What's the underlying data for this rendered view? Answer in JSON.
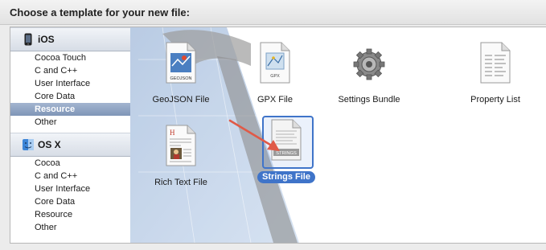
{
  "dialog": {
    "title": "Choose a template for your new file:"
  },
  "sidebar": {
    "groups": [
      {
        "label": "iOS",
        "items": [
          "Cocoa Touch",
          "C and C++",
          "User Interface",
          "Core Data",
          "Resource",
          "Other"
        ]
      },
      {
        "label": "OS X",
        "items": [
          "Cocoa",
          "C and C++",
          "User Interface",
          "Core Data",
          "Resource",
          "Other"
        ]
      }
    ],
    "selected": "iOS / Resource"
  },
  "templates": [
    {
      "label": "GeoJSON File",
      "icon": "geojson-file-icon",
      "icon_text": "GEOJSON"
    },
    {
      "label": "GPX File",
      "icon": "gpx-file-icon",
      "icon_text": "GPX"
    },
    {
      "label": "Settings Bundle",
      "icon": "settings-gear-icon"
    },
    {
      "label": "Property List",
      "icon": "property-list-icon"
    },
    {
      "label": "Rich Text File",
      "icon": "rich-text-file-icon"
    },
    {
      "label": "Strings File",
      "icon": "strings-file-icon",
      "icon_text": "STRINGS",
      "selected": true
    }
  ],
  "colors": {
    "selection": "#3f74c9",
    "sidebar_selection": "#8ea2c2",
    "arrow": "#e05a48"
  }
}
